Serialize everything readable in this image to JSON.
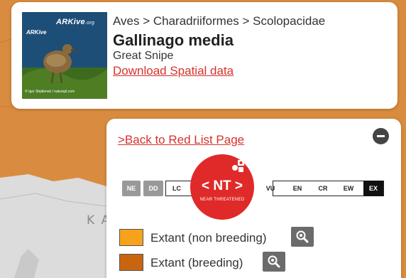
{
  "map": {
    "label": "K A",
    "colors": {
      "range_orange": "#d98c3f",
      "land_grey": "#dcdcdc",
      "water": "#efefef"
    }
  },
  "species": {
    "taxonomy": "Aves > Charadriiformes > Scolopacidae",
    "scientific_name": "Gallinago media",
    "common_name": "Great Snipe",
    "download_label": "Download Spatial data",
    "thumbnail": {
      "logo": "ARKive",
      "logo_suffix": ".org",
      "small_logo": "ARKive",
      "credit": "© Igor Shpilenok / naturepl.com"
    }
  },
  "status": {
    "back_label": ">Back to Red List Page",
    "current": {
      "code": "< NT >",
      "name": "NEAR THREATENED",
      "color": "#e02a2a"
    },
    "categories_left": [
      "NE",
      "DD",
      "LC"
    ],
    "categories_right": [
      "VU",
      "EN",
      "CR",
      "EW",
      "EX"
    ]
  },
  "legend": [
    {
      "label": "Extant (non breeding)",
      "color": "#f7a21c"
    },
    {
      "label": "Extant (breeding)",
      "color": "#c8650e"
    }
  ]
}
